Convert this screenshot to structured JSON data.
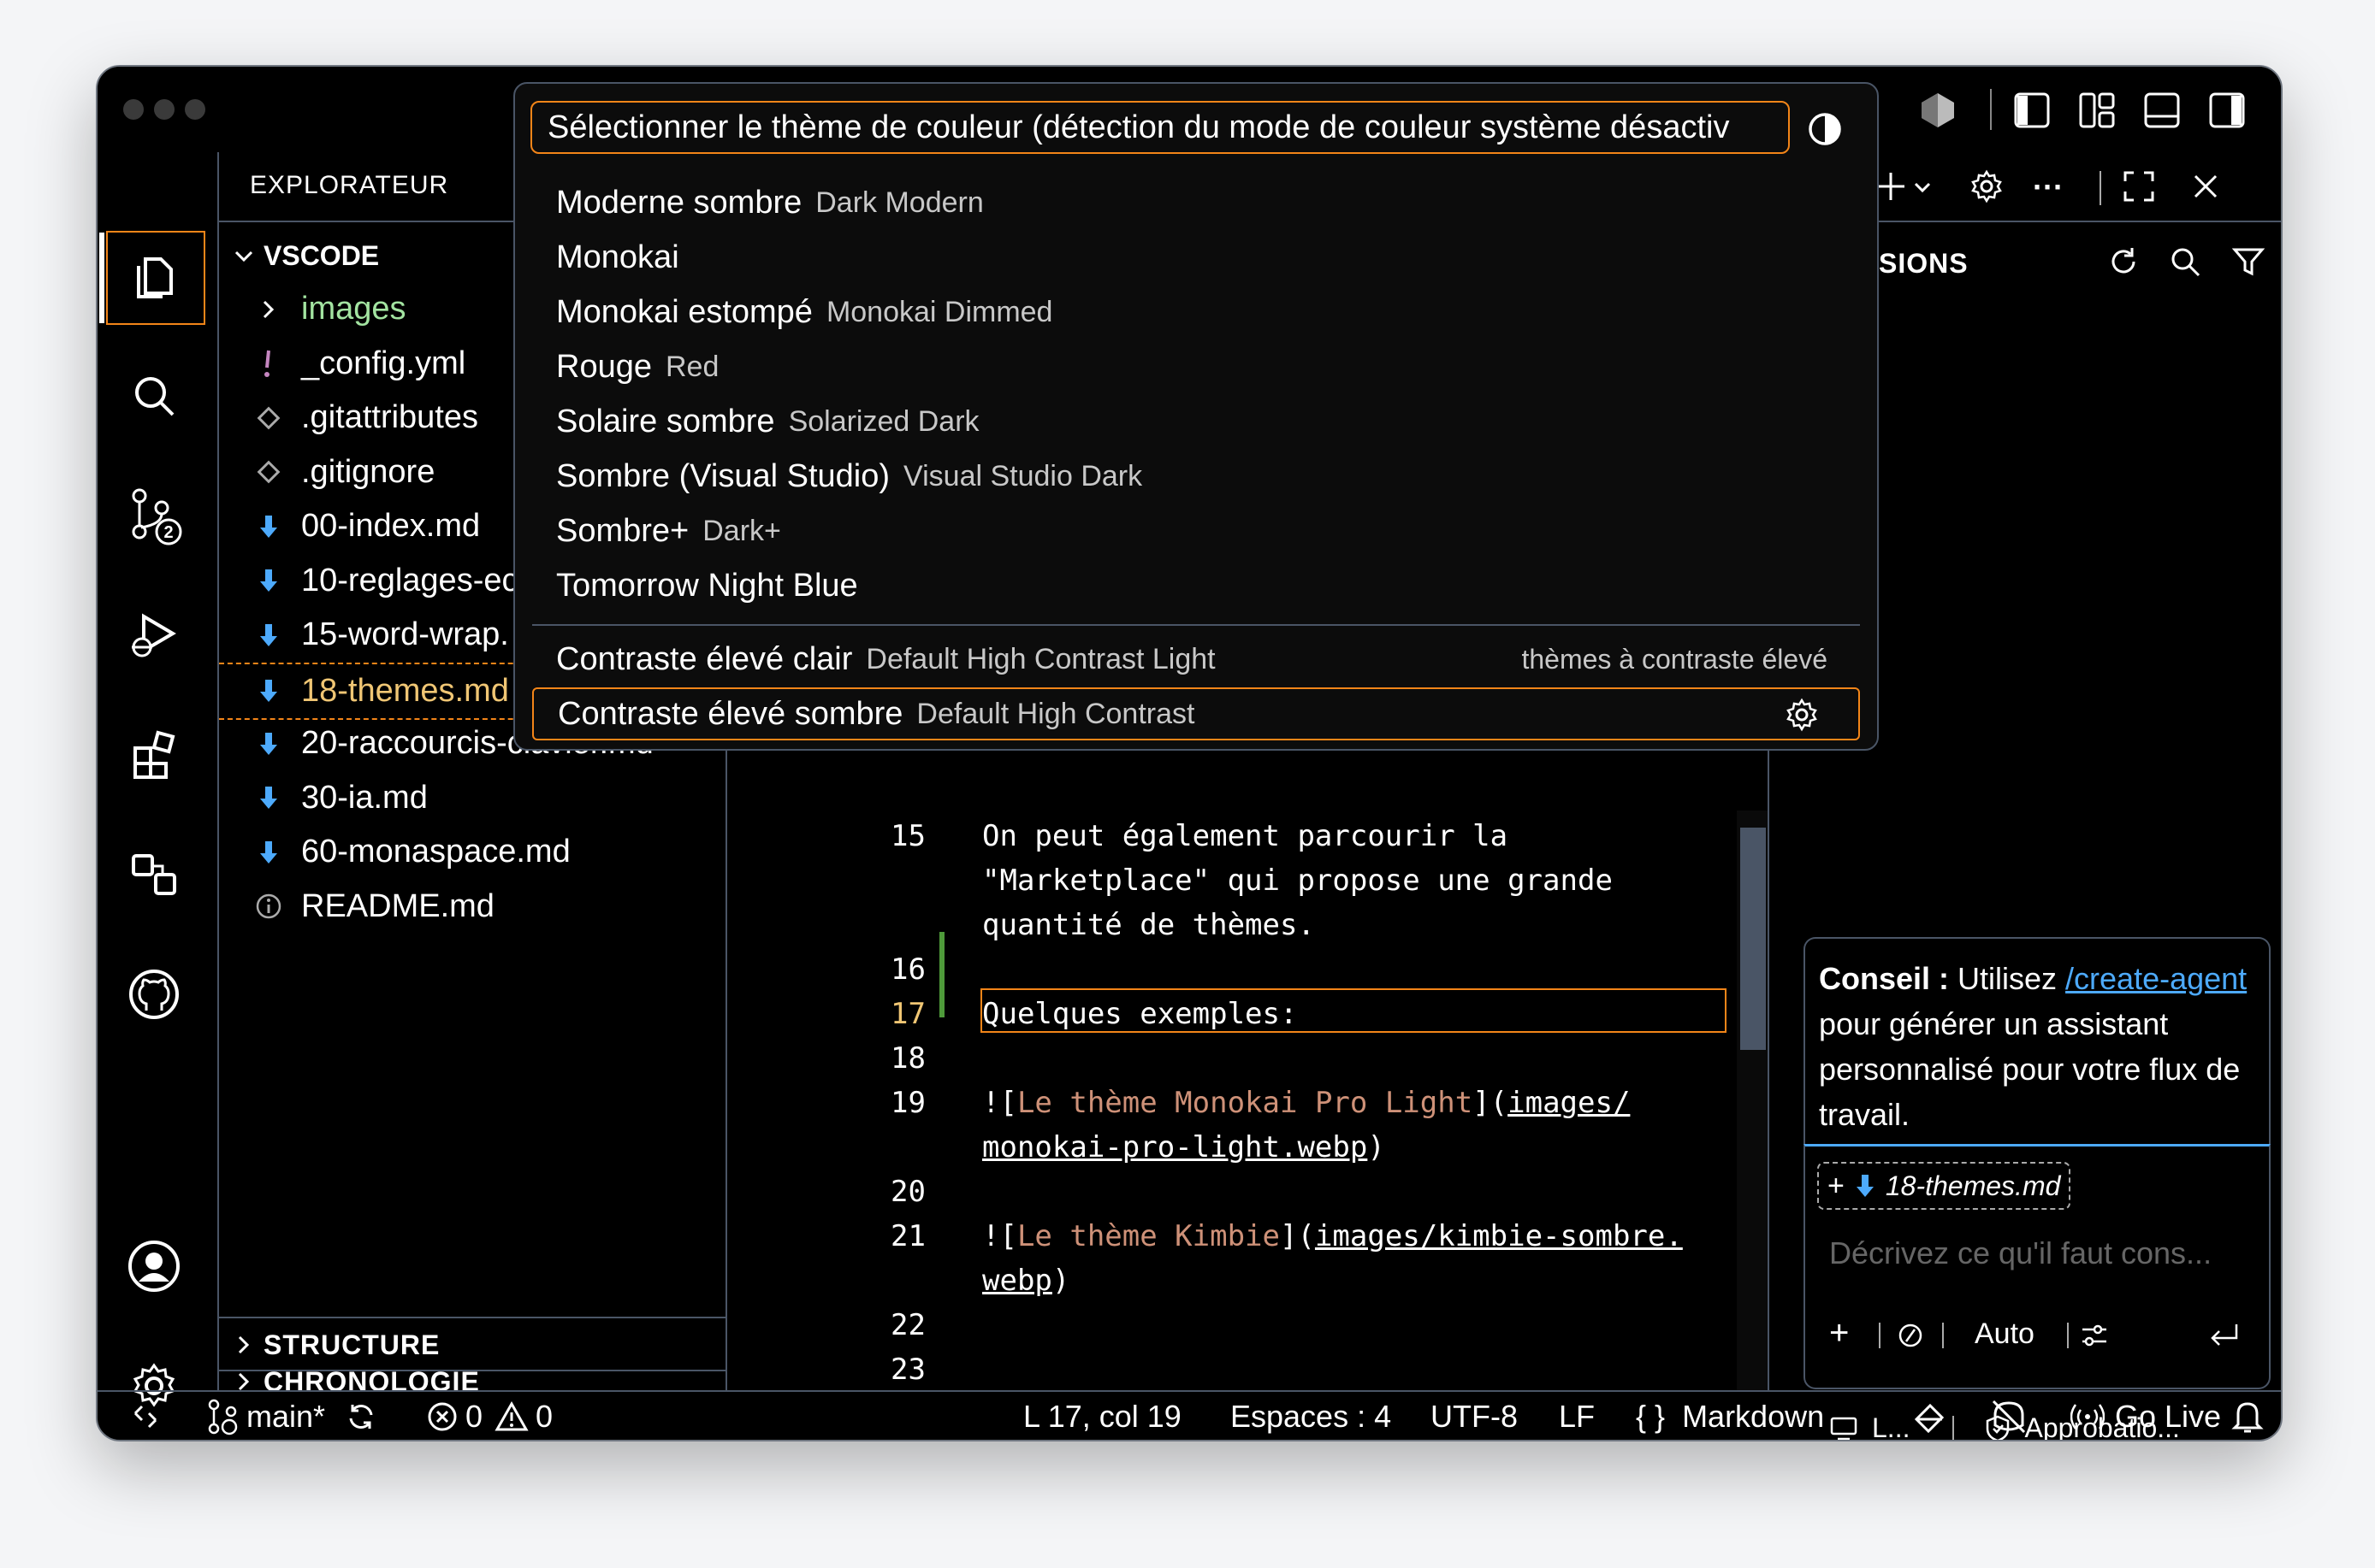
{
  "title_bar": {
    "buttons": [
      "accounts-icon",
      "toggle-primary-sidebar-icon",
      "customize-layout-icon",
      "toggle-panel-icon",
      "toggle-secondary-sidebar-icon"
    ]
  },
  "explorer": {
    "title": "EXPLORATEUR",
    "root": "VSCODE",
    "files": [
      {
        "name": "images",
        "icon": "chevron-right-icon",
        "color": "#a3e4a1"
      },
      {
        "name": "_config.yml",
        "icon": "exclamation-icon",
        "color": "#ffffff"
      },
      {
        "name": ".gitattributes",
        "icon": "git-icon",
        "color": "#ffffff"
      },
      {
        "name": ".gitignore",
        "icon": "git-icon",
        "color": "#ffffff"
      },
      {
        "name": "00-index.md",
        "icon": "markdown-icon",
        "color": "#ffffff"
      },
      {
        "name": "10-reglages-ec",
        "icon": "markdown-icon",
        "color": "#ffffff"
      },
      {
        "name": "15-word-wrap.",
        "icon": "markdown-icon",
        "color": "#ffffff"
      },
      {
        "name": "18-themes.md",
        "icon": "markdown-icon",
        "color": "#f0c674"
      },
      {
        "name": "20-raccourcis-clavier.md",
        "icon": "markdown-icon",
        "color": "#ffffff"
      },
      {
        "name": "30-ia.md",
        "icon": "markdown-icon",
        "color": "#ffffff"
      },
      {
        "name": "60-monaspace.md",
        "icon": "markdown-icon",
        "color": "#ffffff"
      },
      {
        "name": "README.md",
        "icon": "info-icon",
        "color": "#ffffff"
      }
    ],
    "sections": [
      "STRUCTURE",
      "CHRONOLOGIE"
    ]
  },
  "editor": {
    "lines": [
      {
        "num": "15",
        "text": "On peut également parcourir la"
      },
      {
        "num": "",
        "text": "\"Marketplace\" qui propose une grande"
      },
      {
        "num": "",
        "text": "quantité de thèmes."
      },
      {
        "num": "16",
        "text": ""
      },
      {
        "num": "17",
        "text": "Quelques exemples:"
      },
      {
        "num": "18",
        "text": ""
      },
      {
        "num": "19",
        "text_a": "![",
        "text_b": "Le thème Monokai Pro Light",
        "text_c": "](",
        "text_d": "images/"
      },
      {
        "num": "",
        "text_d": "monokai-pro-light.webp",
        "text_e": ")"
      },
      {
        "num": "20",
        "text": ""
      },
      {
        "num": "21",
        "text_a": "![",
        "text_b": "Le thème Kimbie",
        "text_c": "](",
        "text_d": "images/kimbie-sombre."
      },
      {
        "num": "",
        "text_d": "webp",
        "text_e": ")"
      },
      {
        "num": "22",
        "text": ""
      },
      {
        "num": "23",
        "text": ""
      }
    ]
  },
  "right_panel": {
    "header_partial": "SIONS",
    "tip_bold": "Conseil :",
    "tip_pre": " Utilisez ",
    "tip_link": "/create-agent",
    "tip_post": " pour générer un assistant personnalisé pour votre flux de travail.",
    "context_file": "18-themes.md",
    "input_placeholder": "Décrivez ce qu'il faut cons...",
    "mode": "Auto",
    "footer_left": "L...",
    "footer_right": "Approbatio..."
  },
  "quick_pick": {
    "placeholder": "Sélectionner le thème de couleur (détection du mode de couleur système désactiv",
    "items": [
      {
        "label": "Moderne sombre",
        "desc": "Dark Modern"
      },
      {
        "label": "Monokai",
        "desc": ""
      },
      {
        "label": "Monokai estompé",
        "desc": "Monokai Dimmed"
      },
      {
        "label": "Rouge",
        "desc": "Red"
      },
      {
        "label": "Solaire sombre",
        "desc": "Solarized Dark"
      },
      {
        "label": "Sombre (Visual Studio)",
        "desc": "Visual Studio Dark"
      },
      {
        "label": "Sombre+",
        "desc": "Dark+"
      },
      {
        "label": "Tomorrow Night Blue",
        "desc": ""
      },
      {
        "label": "Contraste élevé clair",
        "desc": "Default High Contrast Light",
        "group": "thèmes à contraste élevé"
      },
      {
        "label": "Contraste élevé sombre",
        "desc": "Default High Contrast",
        "focused": true
      }
    ]
  },
  "status_bar": {
    "branch": "main*",
    "errors": "0",
    "warnings": "0",
    "position": "L 17, col 19",
    "spaces": "Espaces : 4",
    "encoding": "UTF-8",
    "eol": "LF",
    "language": "Markdown",
    "go_live": "Go Live"
  },
  "colors": {
    "accent": "#f38518",
    "border": "#4a5566",
    "link": "#4daafc",
    "string": "#ce9178"
  }
}
